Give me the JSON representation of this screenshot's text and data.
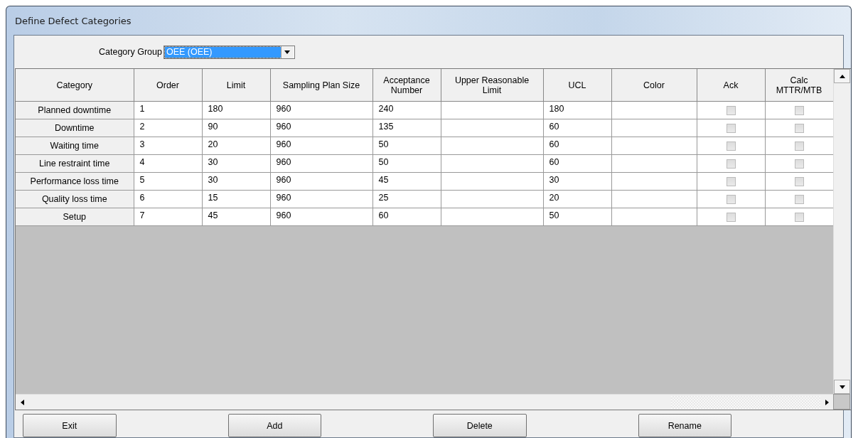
{
  "window": {
    "title": "Define Defect Categories"
  },
  "category_group": {
    "label": "Category Group",
    "value": "OEE (OEE)"
  },
  "table": {
    "columns": [
      {
        "label": "Category"
      },
      {
        "label": "Order"
      },
      {
        "label": "Limit"
      },
      {
        "label": "Sampling Plan Size"
      },
      {
        "label": "Acceptance Number"
      },
      {
        "label": "Upper Reasonable Limit"
      },
      {
        "label": "UCL"
      },
      {
        "label": "Color"
      },
      {
        "label": "Ack"
      },
      {
        "label": "Calc MTTR/MTB"
      }
    ],
    "rows": [
      {
        "category": "Planned downtime",
        "order": "1",
        "limit": "180",
        "sampling_plan_size": "960",
        "acceptance_number": "240",
        "ucl": "180",
        "ack": false,
        "calc": false
      },
      {
        "category": "Downtime",
        "order": "2",
        "limit": "90",
        "sampling_plan_size": "960",
        "acceptance_number": "135",
        "ucl": "60",
        "ack": false,
        "calc": false
      },
      {
        "category": "Waiting time",
        "order": "3",
        "limit": "20",
        "sampling_plan_size": "960",
        "acceptance_number": "50",
        "ucl": "60",
        "ack": false,
        "calc": false
      },
      {
        "category": "Line restraint time",
        "order": "4",
        "limit": "30",
        "sampling_plan_size": "960",
        "acceptance_number": "50",
        "ucl": "60",
        "ack": false,
        "calc": false
      },
      {
        "category": "Performance loss time",
        "order": "5",
        "limit": "30",
        "sampling_plan_size": "960",
        "acceptance_number": "45",
        "ucl": "30",
        "ack": false,
        "calc": false
      },
      {
        "category": "Quality loss time",
        "order": "6",
        "limit": "15",
        "sampling_plan_size": "960",
        "acceptance_number": "25",
        "ucl": "20",
        "ack": false,
        "calc": false
      },
      {
        "category": "Setup",
        "order": "7",
        "limit": "45",
        "sampling_plan_size": "960",
        "acceptance_number": "60",
        "ucl": "50",
        "ack": false,
        "calc": false
      }
    ]
  },
  "buttons": [
    "Exit",
    "Add",
    "Delete",
    "Rename"
  ]
}
